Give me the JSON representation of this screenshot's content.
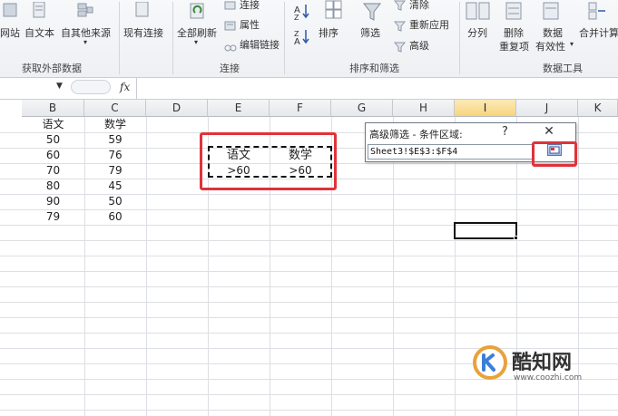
{
  "ribbon": {
    "group1": {
      "btn_web": "网站",
      "btn_text": "自文本",
      "btn_other": "自其他来源",
      "btn_existing": "现有连接",
      "label": "获取外部数据"
    },
    "group2": {
      "btn_refresh_all": "全部刷新",
      "btn_connections": "连接",
      "btn_properties": "属性",
      "btn_edit_links": "编辑链接",
      "label": "连接"
    },
    "group3": {
      "btn_sort": "排序",
      "btn_filter": "筛选",
      "btn_clear": "清除",
      "btn_reapply": "重新应用",
      "btn_advanced": "高级",
      "label": "排序和筛选"
    },
    "group4": {
      "btn_split": "分列",
      "btn_remove_dup_1": "删除",
      "btn_remove_dup_2": "重复项",
      "btn_validation_1": "数据",
      "btn_validation_2": "有效性",
      "btn_consolidate": "合并计算",
      "label": "数据工具"
    }
  },
  "formula_bar": {
    "fx_label": "fx",
    "value": ""
  },
  "columns": [
    "B",
    "C",
    "D",
    "E",
    "F",
    "G",
    "H",
    "I",
    "J",
    "K"
  ],
  "selected_column": "I",
  "table": {
    "headers": [
      "语文",
      "数学"
    ],
    "rows": [
      [
        "50",
        "59"
      ],
      [
        "60",
        "76"
      ],
      [
        "70",
        "79"
      ],
      [
        "80",
        "45"
      ],
      [
        "90",
        "50"
      ],
      [
        "79",
        "60"
      ]
    ]
  },
  "criteria": {
    "headers": [
      "语文",
      "数学"
    ],
    "values": [
      ">60",
      ">60"
    ]
  },
  "dialog": {
    "title": "高级筛选 - 条件区域:",
    "help": "?",
    "close": "✕",
    "range_value": "Sheet3!$E$3:$F$4"
  },
  "watermark": {
    "brand": "酷知网",
    "url": "www.coozhi.com"
  },
  "colors": {
    "highlight_red": "#e0323a",
    "selected_column": "#f6d57b"
  }
}
